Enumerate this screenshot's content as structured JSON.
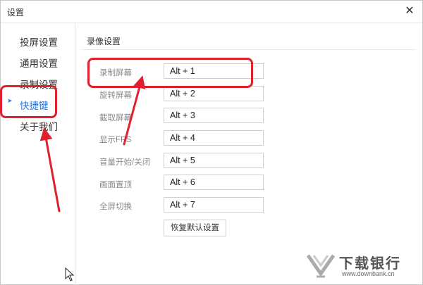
{
  "window": {
    "title": "设置"
  },
  "sidebar": {
    "items": [
      {
        "label": "投屏设置",
        "active": false
      },
      {
        "label": "通用设置",
        "active": false
      },
      {
        "label": "录制设置",
        "active": false
      },
      {
        "label": "快捷键",
        "active": true
      },
      {
        "label": "关于我们",
        "active": false
      }
    ]
  },
  "main": {
    "section_title": "录像设置",
    "hotkeys": [
      {
        "label": "录制屏幕",
        "value": "Alt + 1"
      },
      {
        "label": "旋转屏幕",
        "value": "Alt + 2"
      },
      {
        "label": "截取屏幕",
        "value": "Alt + 3"
      },
      {
        "label": "显示FPS",
        "value": "Alt + 4"
      },
      {
        "label": "音量开始/关闭",
        "value": "Alt + 5"
      },
      {
        "label": "画面置顶",
        "value": "Alt + 6"
      },
      {
        "label": "全屏切换",
        "value": "Alt + 7"
      }
    ],
    "reset_label": "恢复默认设置"
  },
  "icons": {
    "close": "close-icon",
    "active_marker": "chevron-right-icon",
    "cursor": "mouse-pointer-icon"
  },
  "colors": {
    "accent": "#2f74d3",
    "annotation": "#e0202c"
  },
  "watermark": {
    "brand": "下载银行",
    "url": "www.downbank.cn"
  }
}
